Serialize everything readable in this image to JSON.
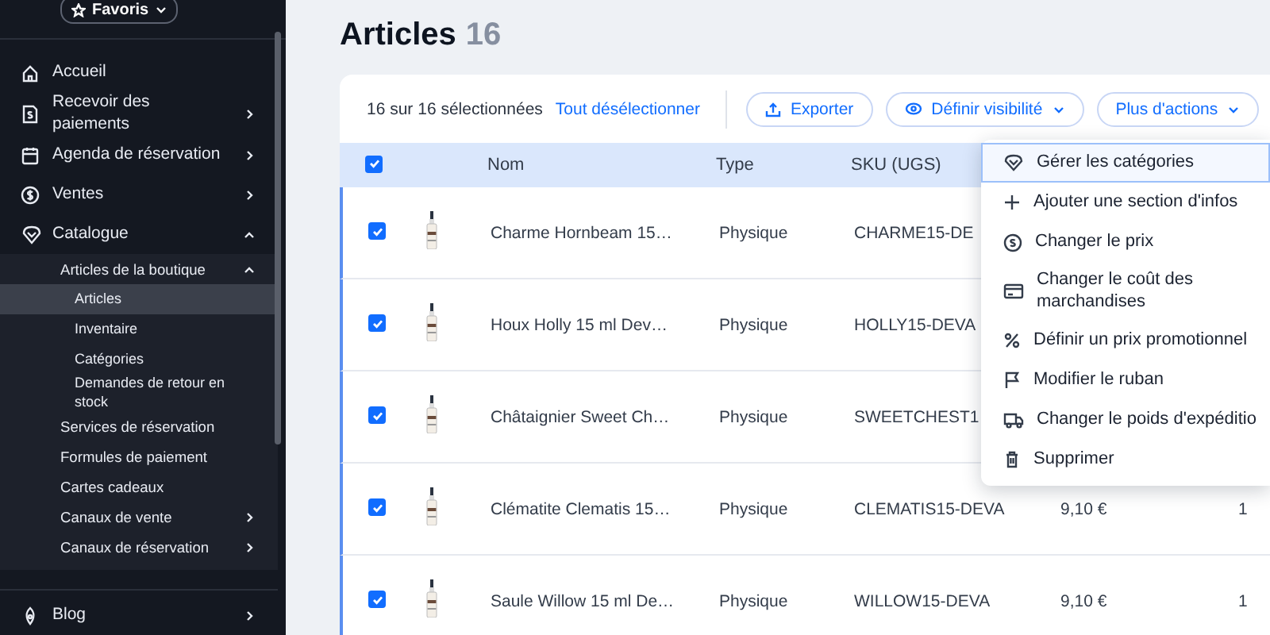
{
  "sidebar": {
    "favorites_button": "Favoris",
    "items": [
      {
        "label": "Accueil",
        "selected": false
      },
      {
        "label": "Recevoir des paiements",
        "selected": false,
        "expanded": false
      },
      {
        "label": "Agenda de réservation",
        "selected": false,
        "expanded": false
      },
      {
        "label": "Ventes",
        "selected": false,
        "expanded": false
      },
      {
        "label": "Catalogue",
        "selected": false,
        "expanded": true,
        "children": [
          {
            "label": "Articles de la boutique",
            "selected": false,
            "expanded": true,
            "children": [
              {
                "label": "Articles",
                "selected": true
              },
              {
                "label": "Inventaire",
                "selected": false
              },
              {
                "label": "Catégories",
                "selected": false
              },
              {
                "label": "Demandes de retour en stock",
                "selected": false
              }
            ]
          },
          {
            "label": "Services de réservation",
            "selected": false
          },
          {
            "label": "Formules de paiement",
            "selected": false
          },
          {
            "label": "Cartes cadeaux",
            "selected": false
          },
          {
            "label": "Canaux de vente",
            "selected": false,
            "expanded": false
          },
          {
            "label": "Canaux de réservation",
            "selected": false,
            "expanded": false
          }
        ]
      },
      {
        "label": "Blog",
        "selected": false,
        "expanded": false
      }
    ]
  },
  "page": {
    "title": "Articles",
    "count": "16"
  },
  "toolbar": {
    "selection": "16 sur 16 sélectionnées",
    "deselect_link": "Tout désélectionner",
    "buttons": [
      {
        "label": "Exporter"
      },
      {
        "label": "Définir visibilité"
      },
      {
        "label": "Plus d'actions"
      }
    ]
  },
  "table": {
    "all_checked": true,
    "columns": [
      "Nom",
      "Type",
      "SKU (UGS)"
    ],
    "rows": [
      {
        "checked": true,
        "name": "Charme Hornbeam 15…",
        "type": "Physique",
        "sku": "CHARME15-DE"
      },
      {
        "checked": true,
        "name": "Houx Holly 15 ml Dev…",
        "type": "Physique",
        "sku": "HOLLY15-DEVA"
      },
      {
        "checked": true,
        "name": "Châtaignier Sweet Ch…",
        "type": "Physique",
        "sku": "SWEETCHEST1"
      },
      {
        "checked": true,
        "name": "Clématite Clematis 15…",
        "type": "Physique",
        "sku": "CLEMATIS15-DEVA",
        "price": "9,10 €",
        "column_6": "1"
      },
      {
        "checked": true,
        "name": "Saule Willow 15 ml De…",
        "type": "Physique",
        "sku": "WILLOW15-DEVA",
        "price": "9,10 €",
        "column_6": "1"
      }
    ]
  },
  "actions_menu": {
    "items": [
      {
        "label": "Gérer les catégories",
        "selected": true
      },
      {
        "label": "Ajouter une section d'infos",
        "selected": false
      },
      {
        "label": "Changer le prix",
        "selected": false
      },
      {
        "label": "Changer le coût des marchandises",
        "selected": false
      },
      {
        "label": "Définir un prix promotionnel",
        "selected": false
      },
      {
        "label": "Modifier le ruban",
        "selected": false
      },
      {
        "label": "Changer le poids d'expéditio",
        "selected": false
      },
      {
        "label": "Supprimer",
        "selected": false
      }
    ]
  }
}
